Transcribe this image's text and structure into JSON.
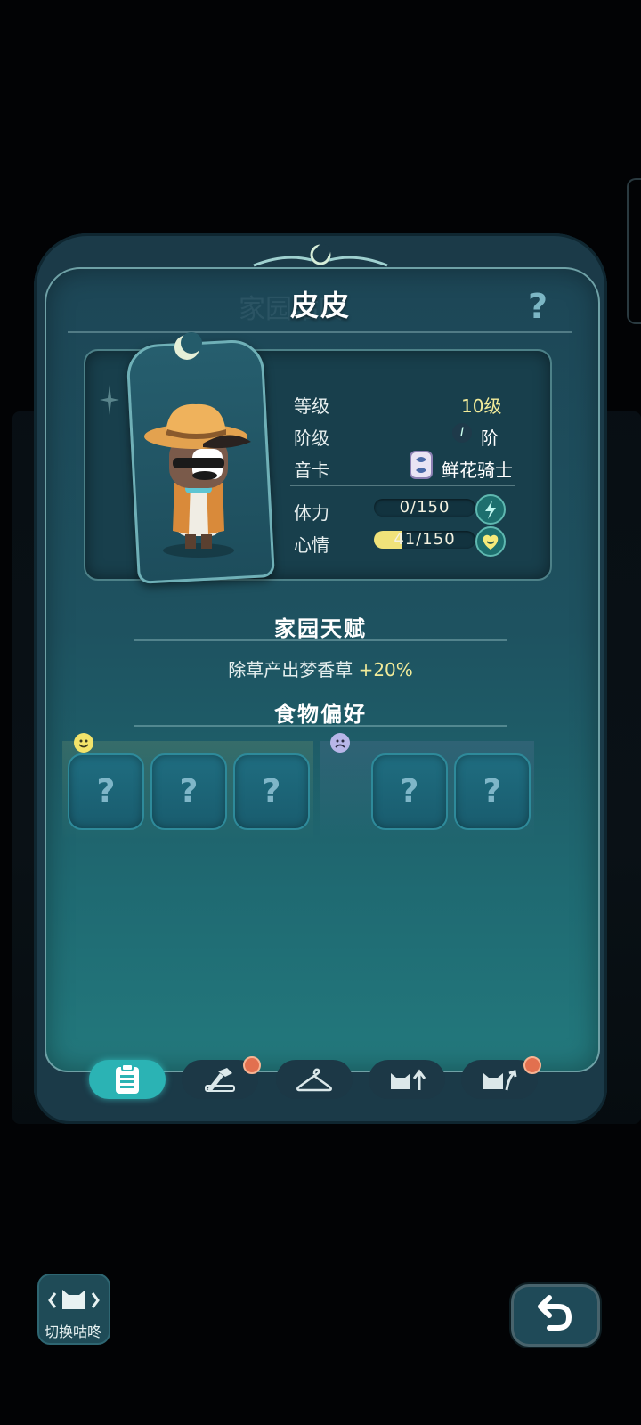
{
  "character": {
    "name": "皮皮",
    "watermark": "家园咕咚"
  },
  "stats": {
    "level_label": "等级",
    "level_value": "10级",
    "stage_label": "阶级",
    "stage_num": "I",
    "stage_value": "阶",
    "card_label": "音卡",
    "card_value": "鲜花骑士",
    "stamina_label": "体力",
    "stamina_text": "0/150",
    "stamina_current": 0,
    "stamina_max": 150,
    "mood_label": "心情",
    "mood_text": "41/150",
    "mood_current": 41,
    "mood_max": 150
  },
  "talent": {
    "title": "家园天赋",
    "text": "除草产出梦香草 ",
    "bonus": "+20%"
  },
  "food": {
    "title": "食物偏好",
    "liked": [
      "?",
      "?",
      "?"
    ],
    "disliked": [
      "?",
      "?"
    ]
  },
  "tabs": [
    {
      "icon": "clipboard-icon",
      "active": true,
      "badge": false
    },
    {
      "icon": "tools-icon",
      "active": false,
      "badge": true
    },
    {
      "icon": "hanger-icon",
      "active": false,
      "badge": false
    },
    {
      "icon": "cat-upgrade-icon",
      "active": false,
      "badge": false
    },
    {
      "icon": "cat-evolve-icon",
      "active": false,
      "badge": true
    }
  ],
  "bottom": {
    "switch_label": "切换咕咚"
  },
  "colors": {
    "accent": "#2bb3b4",
    "value_yellow": "#f3ec9a",
    "badge_red": "#e2704f"
  }
}
